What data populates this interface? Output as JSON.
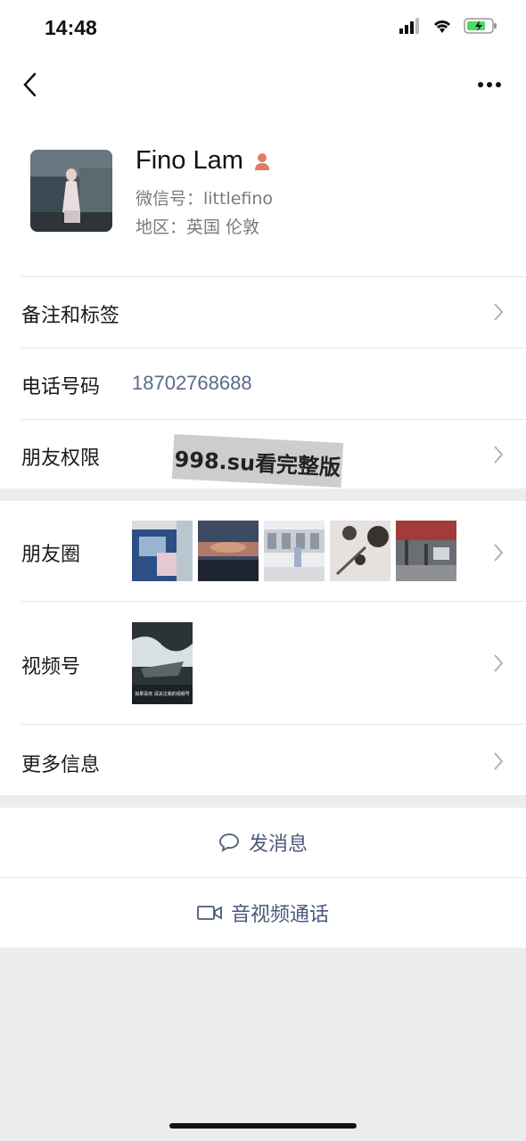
{
  "status_bar": {
    "time": "14:48"
  },
  "profile": {
    "name": "Fino Lam",
    "wechat_id": "微信号：littlefino",
    "region": "地区：英国 伦敦"
  },
  "rows": {
    "remarks_label": "备注和标签",
    "phone_label": "电话号码",
    "phone_value": "18702768688",
    "permissions_label": "朋友权限",
    "moments_label": "朋友圈",
    "channels_label": "视频号",
    "more_info_label": "更多信息"
  },
  "watermark": "998.su看完整版",
  "video_caption": "如果喜欢 请关注我的视频号",
  "actions": {
    "message_label": "发消息",
    "call_label": "音视频通话"
  },
  "colors": {
    "accent": "#4a5a78",
    "gender_icon": "#e07a6a",
    "battery": "#4cd964"
  },
  "icons": [
    "back-icon",
    "more-icon",
    "gender-female-icon",
    "chevron-right-icon",
    "chat-bubble-icon",
    "video-camera-icon"
  ]
}
